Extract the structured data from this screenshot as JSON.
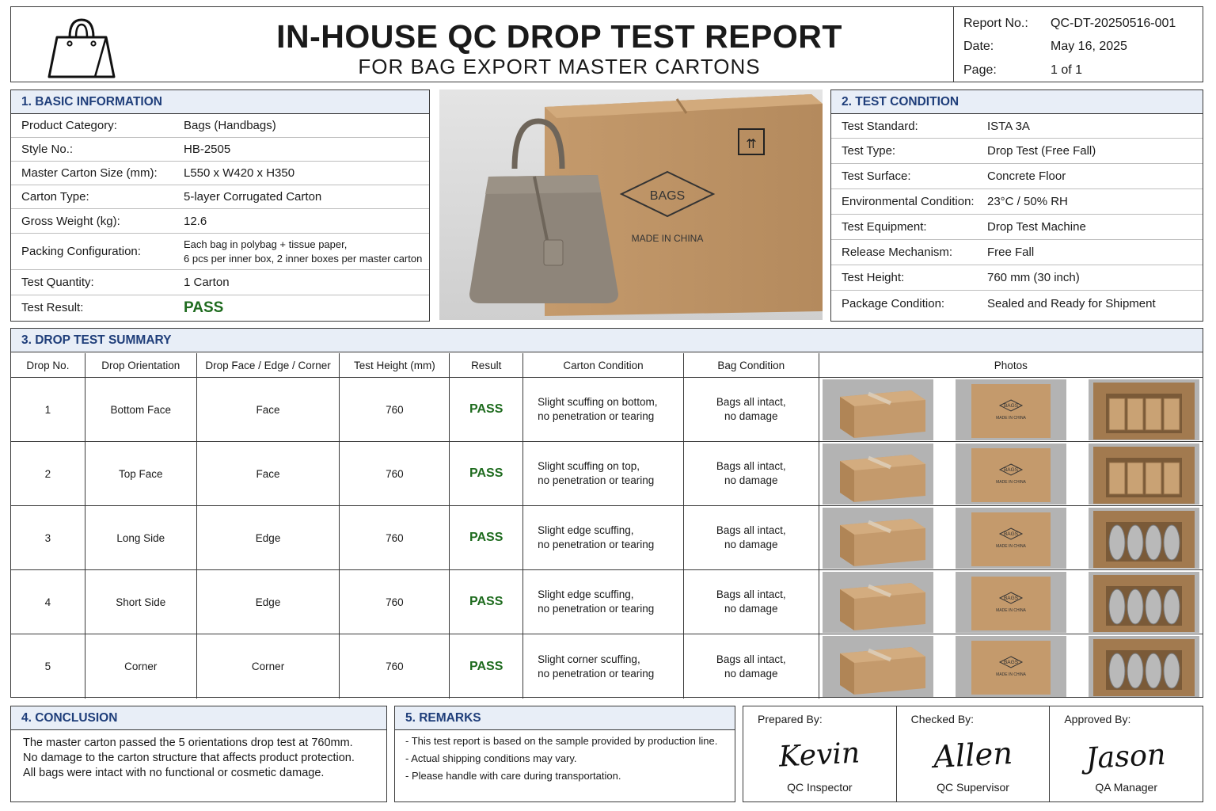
{
  "header": {
    "title": "IN-HOUSE QC DROP TEST REPORT",
    "subtitle": "FOR BAG EXPORT MASTER CARTONS",
    "logo_icon": "handbag-icon",
    "meta": [
      {
        "label": "Report No.:",
        "value": "QC-DT-20250516-001"
      },
      {
        "label": "Date:",
        "value": "May 16, 2025"
      },
      {
        "label": "Page:",
        "value": "1 of 1"
      }
    ]
  },
  "basic": {
    "heading": "1. BASIC INFORMATION",
    "rows": [
      {
        "label": "Product Category:",
        "value": "Bags (Handbags)"
      },
      {
        "label": "Style No.:",
        "value": "HB-2505"
      },
      {
        "label": "Master Carton Size (mm):",
        "value": "L550 x W420 x H350"
      },
      {
        "label": "Carton Type:",
        "value": "5-layer Corrugated Carton"
      },
      {
        "label": "Gross Weight (kg):",
        "value": "12.6"
      },
      {
        "label": "Packing Configuration:",
        "value": "Each bag in polybag + tissue paper,",
        "value2": "6 pcs per inner box, 2 inner boxes per master carton"
      },
      {
        "label": "Test Quantity:",
        "value": "1 Carton"
      },
      {
        "label": "Test Result:",
        "value": "PASS"
      }
    ]
  },
  "photo_main": {
    "carton_text": "BAGS",
    "carton_origin": "MADE IN CHINA"
  },
  "condition": {
    "heading": "2. TEST CONDITION",
    "rows": [
      {
        "label": "Test Standard:",
        "value": "ISTA 3A"
      },
      {
        "label": "Test Type:",
        "value": "Drop Test (Free Fall)"
      },
      {
        "label": "Test Surface:",
        "value": "Concrete Floor"
      },
      {
        "label": "Environmental Condition:",
        "value": "23°C / 50% RH"
      },
      {
        "label": "Test Equipment:",
        "value": "Drop Test Machine"
      },
      {
        "label": "Release Mechanism:",
        "value": "Free Fall"
      },
      {
        "label": "Test Height:",
        "value": "760 mm (30 inch)"
      },
      {
        "label": "Package Condition:",
        "value": "Sealed and Ready for Shipment"
      }
    ]
  },
  "summary": {
    "heading": "3. DROP TEST SUMMARY",
    "columns": [
      "Drop No.",
      "Drop Orientation",
      "Drop Face / Edge / Corner",
      "Test Height (mm)",
      "Result",
      "Carton Condition",
      "Bag Condition",
      "Photos"
    ],
    "rows": [
      {
        "no": "1",
        "orientation": "Bottom Face",
        "type": "Face",
        "height": "760",
        "result": "PASS",
        "carton1": "Slight scuffing on bottom,",
        "carton2": "no penetration or tearing",
        "bag1": "Bags all intact,",
        "bag2": "no damage"
      },
      {
        "no": "2",
        "orientation": "Top Face",
        "type": "Face",
        "height": "760",
        "result": "PASS",
        "carton1": "Slight scuffing on top,",
        "carton2": "no penetration or tearing",
        "bag1": "Bags all intact,",
        "bag2": "no damage"
      },
      {
        "no": "3",
        "orientation": "Long Side",
        "type": "Edge",
        "height": "760",
        "result": "PASS",
        "carton1": "Slight edge scuffing,",
        "carton2": "no penetration or tearing",
        "bag1": "Bags all intact,",
        "bag2": "no damage"
      },
      {
        "no": "4",
        "orientation": "Short Side",
        "type": "Edge",
        "height": "760",
        "result": "PASS",
        "carton1": "Slight edge scuffing,",
        "carton2": "no penetration or tearing",
        "bag1": "Bags all intact,",
        "bag2": "no damage"
      },
      {
        "no": "5",
        "orientation": "Corner",
        "type": "Corner",
        "height": "760",
        "result": "PASS",
        "carton1": "Slight corner scuffing,",
        "carton2": "no penetration or tearing",
        "bag1": "Bags all intact,",
        "bag2": "no damage"
      }
    ],
    "thumb_label": "BAGS",
    "thumb_origin": "MADE IN CHINA"
  },
  "conclusion": {
    "heading": "4. CONCLUSION",
    "lines": [
      "The master carton passed the 5 orientations drop test at 760mm.",
      "No damage to the carton structure that affects product protection.",
      "All bags were intact with no functional or cosmetic damage."
    ]
  },
  "remarks": {
    "heading": "5. REMARKS",
    "lines": [
      "- This test report is based on the sample provided by production line.",
      "- Actual shipping conditions may vary.",
      "- Please handle with care during transportation."
    ]
  },
  "signatures": [
    {
      "label": "Prepared By:",
      "name": "Kevin",
      "role": "QC Inspector"
    },
    {
      "label": "Checked By:",
      "name": "Allen",
      "role": "QC Supervisor"
    },
    {
      "label": "Approved By:",
      "name": "Jason",
      "role": "QA Manager"
    }
  ],
  "colors": {
    "pass": "#1e6b1e",
    "heading": "#1f3e7a",
    "heading_bg": "#e8eef7",
    "kraft": "#c49a6c"
  }
}
